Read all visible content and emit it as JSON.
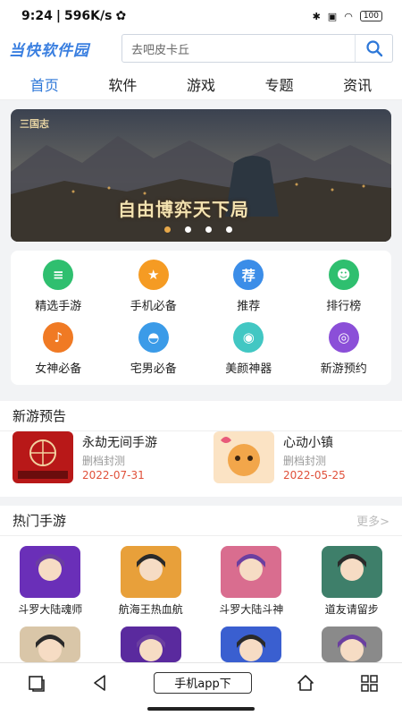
{
  "status_bar": {
    "time": "9:24",
    "speed": "596K/s",
    "battery": "100"
  },
  "header": {
    "logo": "当快软件园",
    "search_placeholder": "去吧皮卡丘"
  },
  "nav": {
    "tabs": [
      {
        "label": "首页",
        "active": true
      },
      {
        "label": "软件",
        "active": false
      },
      {
        "label": "游戏",
        "active": false
      },
      {
        "label": "专题",
        "active": false
      },
      {
        "label": "资讯",
        "active": false
      }
    ]
  },
  "banner": {
    "logo_text": "三国志",
    "title": "自由博弈天下局",
    "dots": 4,
    "active_dot": 0
  },
  "quick_icons": [
    {
      "label": "精选手游",
      "icon": "stack-icon",
      "glyph": "≡",
      "color": "#2fbf6f"
    },
    {
      "label": "手机必备",
      "icon": "phone-star-icon",
      "glyph": "★",
      "color": "#f59b23"
    },
    {
      "label": "推荐",
      "icon": "recommend-icon",
      "glyph": "荐",
      "color": "#3b8de8"
    },
    {
      "label": "排行榜",
      "icon": "robot-icon",
      "glyph": "☻",
      "color": "#2fbf6f"
    },
    {
      "label": "女神必备",
      "icon": "microphone-icon",
      "glyph": "♪",
      "color": "#f07a24"
    },
    {
      "label": "宅男必备",
      "icon": "android-icon",
      "glyph": "◓",
      "color": "#3b9be8"
    },
    {
      "label": "美颜神器",
      "icon": "camera-icon",
      "glyph": "◉",
      "color": "#42c7c3"
    },
    {
      "label": "新游预约",
      "icon": "target-icon",
      "glyph": "◎",
      "color": "#8b4fd8"
    }
  ],
  "new_games": {
    "title": "新游预告",
    "items": [
      {
        "name": "永劫无间手游",
        "status": "删档封测",
        "date": "2022-07-31",
        "thumb_color": "#c21a1a"
      },
      {
        "name": "心动小镇",
        "status": "删档封测",
        "date": "2022-05-25",
        "thumb_color": "#f2a64a"
      }
    ]
  },
  "hot_games": {
    "title": "热门手游",
    "more": "更多>",
    "items": [
      {
        "name": "斗罗大陆魂师",
        "thumb_color": "#6a2fb8"
      },
      {
        "name": "航海王热血航",
        "thumb_color": "#e8a03a"
      },
      {
        "name": "斗罗大陆斗神",
        "thumb_color": "#d96d8f"
      },
      {
        "name": "道友请留步",
        "thumb_color": "#3e7f6a"
      }
    ],
    "row2": [
      {
        "thumb_color": "#d9c6a8"
      },
      {
        "thumb_color": "#5a2a9e"
      },
      {
        "thumb_color": "#3a5fd0"
      },
      {
        "thumb_color": "#8a8a8a"
      }
    ]
  },
  "bottom_bar": {
    "download_label": "手机app下"
  }
}
